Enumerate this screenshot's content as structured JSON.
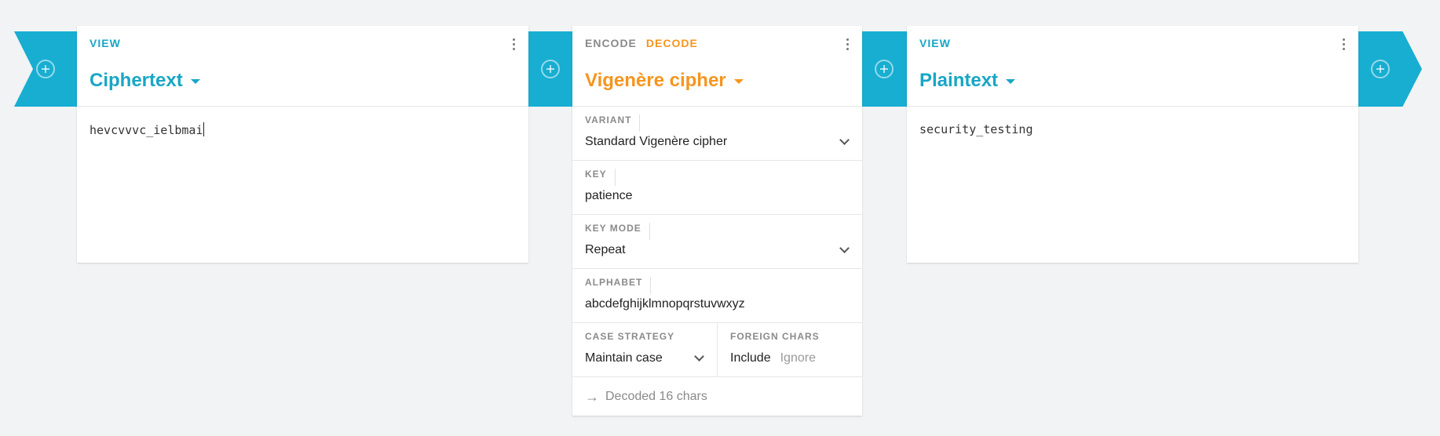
{
  "pipes": [
    {
      "icon": "add-circle-icon"
    },
    {
      "icon": "add-circle-icon"
    },
    {
      "icon": "add-circle-icon"
    },
    {
      "icon": "add-circle-icon"
    }
  ],
  "view_left": {
    "mode_label": "VIEW",
    "title": "Ciphertext",
    "content": "hevcvvvc_ielbmai"
  },
  "cipher": {
    "encode_label": "ENCODE",
    "decode_label": "DECODE",
    "title": "Vigenère cipher",
    "variant": {
      "label": "VARIANT",
      "value": "Standard Vigenère cipher"
    },
    "key": {
      "label": "KEY",
      "value": "patience"
    },
    "key_mode": {
      "label": "KEY MODE",
      "value": "Repeat"
    },
    "alphabet": {
      "label": "ALPHABET",
      "value": "abcdefghijklmnopqrstuvwxyz"
    },
    "case_strategy": {
      "label": "CASE STRATEGY",
      "value": "Maintain case"
    },
    "foreign_chars": {
      "label": "FOREIGN CHARS",
      "include": "Include",
      "ignore": "Ignore"
    },
    "status": "Decoded 16 chars"
  },
  "view_right": {
    "mode_label": "VIEW",
    "title": "Plaintext",
    "content": "security_testing"
  },
  "colors": {
    "accent_blue": "#17aed1",
    "accent_orange": "#f6951e",
    "background": "#f2f3f4"
  }
}
